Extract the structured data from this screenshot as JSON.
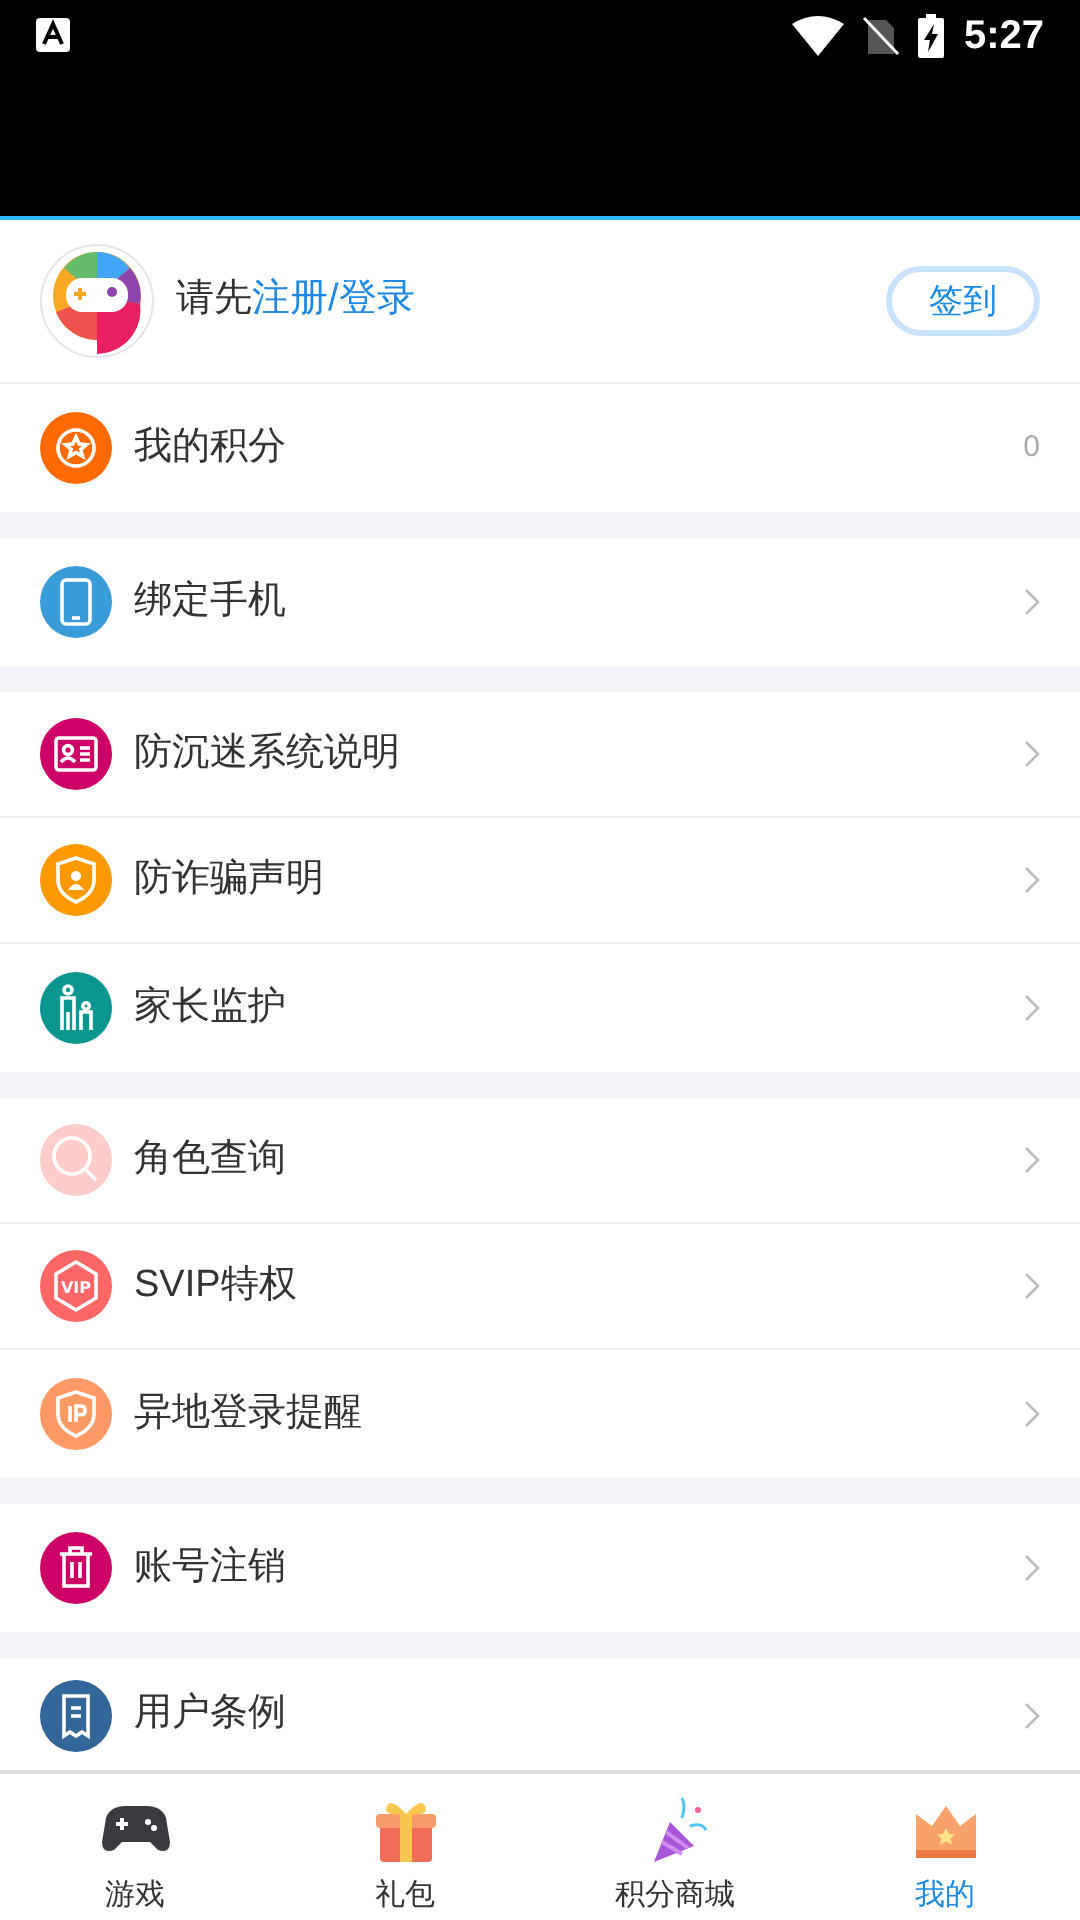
{
  "status_bar": {
    "time": "5:27"
  },
  "profile": {
    "prompt": "请先",
    "login_link": "注册/登录",
    "checkin_button": "签到"
  },
  "sections": [
    {
      "items": [
        {
          "label": "我的积分",
          "kind": "value",
          "value": "0",
          "color": "#ff6a00"
        }
      ]
    },
    {
      "items": [
        {
          "label": "绑定手机",
          "kind": "chevron",
          "color": "#3a9bd9"
        }
      ]
    },
    {
      "items": [
        {
          "label": "防沉迷系统说明",
          "kind": "chevron",
          "color": "#cc0066"
        },
        {
          "label": "防诈骗声明",
          "kind": "chevron",
          "color": "#ff9900"
        },
        {
          "label": "家长监护",
          "kind": "chevron",
          "color": "#0b9690"
        }
      ]
    },
    {
      "items": [
        {
          "label": "角色查询",
          "kind": "chevron",
          "color": "#ffcccc"
        },
        {
          "label": "SVIP特权",
          "kind": "chevron",
          "color": "#ff6666",
          "icon_text": "VIP"
        },
        {
          "label": "异地登录提醒",
          "kind": "chevron",
          "color": "#ff9966"
        }
      ]
    },
    {
      "items": [
        {
          "label": "账号注销",
          "kind": "chevron",
          "color": "#cc0066"
        }
      ]
    },
    {
      "items": [
        {
          "label": "用户条例",
          "kind": "chevron",
          "color": "#336699"
        }
      ]
    }
  ],
  "tab_bar": [
    {
      "label": "游戏",
      "selected": false
    },
    {
      "label": "礼包",
      "selected": false
    },
    {
      "label": "积分商城",
      "selected": false
    },
    {
      "label": "我的",
      "selected": true
    }
  ]
}
